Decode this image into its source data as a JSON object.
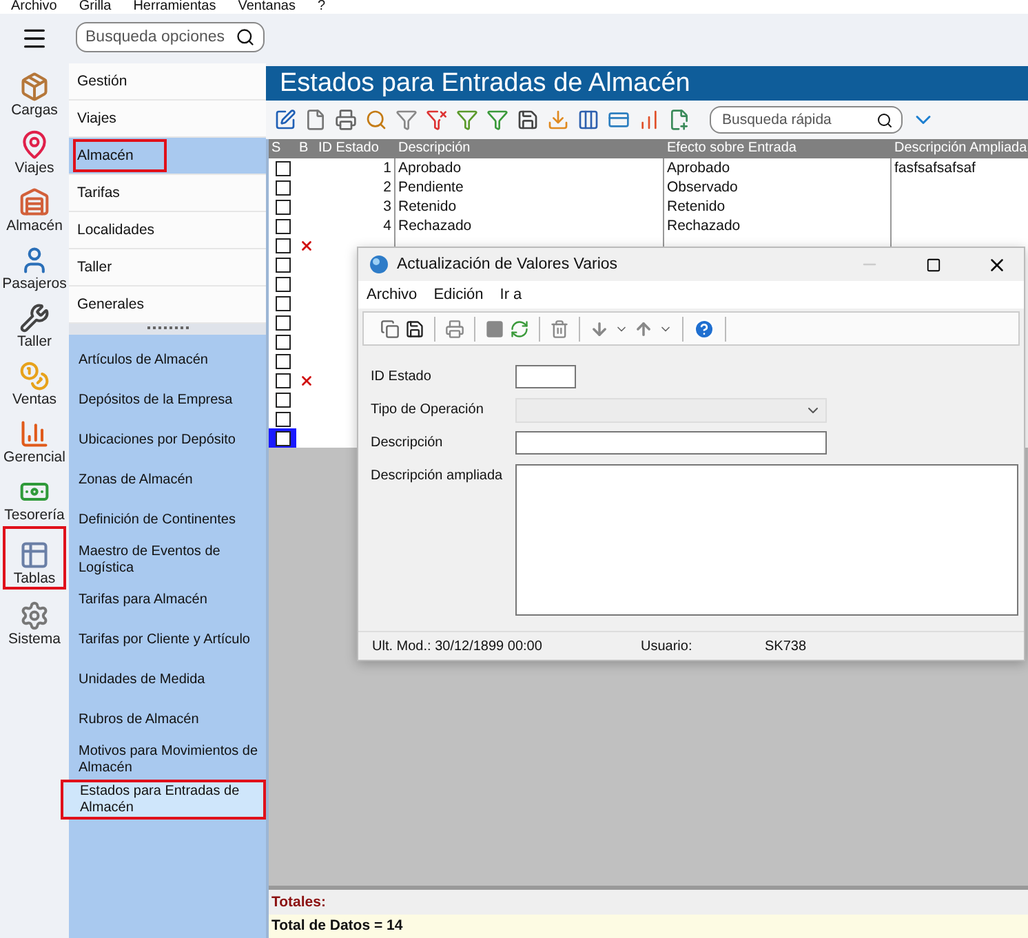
{
  "menubar": [
    "Archivo",
    "Grilla",
    "Herramientas",
    "Ventanas",
    "?"
  ],
  "search": {
    "placeholder": "Busqueda opciones"
  },
  "modules": [
    {
      "label": "Cargas",
      "kind": "package",
      "highlighted": false
    },
    {
      "label": "Viajes",
      "kind": "pin",
      "highlighted": false
    },
    {
      "label": "Almacén",
      "kind": "warehouse",
      "highlighted": false
    },
    {
      "label": "Pasajeros",
      "kind": "person",
      "highlighted": false
    },
    {
      "label": "Taller",
      "kind": "wrench",
      "highlighted": false
    },
    {
      "label": "Ventas",
      "kind": "coins",
      "highlighted": false
    },
    {
      "label": "Gerencial",
      "kind": "chart",
      "highlighted": false
    },
    {
      "label": "Tesorería",
      "kind": "cash",
      "highlighted": false
    },
    {
      "label": "Tablas",
      "kind": "table",
      "highlighted": true
    },
    {
      "label": "Sistema",
      "kind": "gear",
      "highlighted": false
    }
  ],
  "nav_groups": [
    {
      "label": "Gestión",
      "selected": false,
      "highlighted": false
    },
    {
      "label": "Viajes",
      "selected": false,
      "highlighted": false
    },
    {
      "label": "Almacén",
      "selected": true,
      "highlighted": true
    },
    {
      "label": "Tarifas",
      "selected": false,
      "highlighted": false
    },
    {
      "label": "Localidades",
      "selected": false,
      "highlighted": false
    },
    {
      "label": "Taller",
      "selected": false,
      "highlighted": false
    },
    {
      "label": "Generales",
      "selected": false,
      "highlighted": false
    }
  ],
  "nav_items": [
    {
      "label": "Artículos de Almacén",
      "selected": false,
      "highlighted": false
    },
    {
      "label": "Depósitos de la Empresa",
      "selected": false,
      "highlighted": false
    },
    {
      "label": "Ubicaciones por Depósito",
      "selected": false,
      "highlighted": false
    },
    {
      "label": "Zonas de Almacén",
      "selected": false,
      "highlighted": false
    },
    {
      "label": "Definición de Continentes",
      "selected": false,
      "highlighted": false
    },
    {
      "label": "Maestro de Eventos de Logística",
      "selected": false,
      "highlighted": false
    },
    {
      "label": "Tarifas para Almacén",
      "selected": false,
      "highlighted": false
    },
    {
      "label": "Tarifas por Cliente y Artículo",
      "selected": false,
      "highlighted": false
    },
    {
      "label": "Unidades de Medida",
      "selected": false,
      "highlighted": false
    },
    {
      "label": "Rubros de Almacén",
      "selected": false,
      "highlighted": false
    },
    {
      "label": "Motivos para Movimientos de Almacén",
      "selected": false,
      "highlighted": false
    },
    {
      "label": "Estados para Entradas de Almacén",
      "selected": true,
      "highlighted": true
    }
  ],
  "page_title": "Estados para Entradas de Almacén",
  "quick_search": {
    "placeholder": "Busqueda rápida"
  },
  "table": {
    "columns": [
      "S",
      "B",
      "ID Estado",
      "Descripción",
      "Efecto sobre Entrada",
      "Descripción Ampliada"
    ],
    "rows": [
      {
        "checked": false,
        "deleted": false,
        "selected": false,
        "id": "1",
        "description": "Aprobado",
        "effect": "Aprobado",
        "extended": "fasfsafsafsaf"
      },
      {
        "checked": false,
        "deleted": false,
        "selected": false,
        "id": "2",
        "description": "Pendiente",
        "effect": "Observado"
      },
      {
        "checked": false,
        "deleted": false,
        "selected": false,
        "id": "3",
        "description": "Retenido",
        "effect": "Retenido"
      },
      {
        "checked": false,
        "deleted": false,
        "selected": false,
        "id": "4",
        "description": "Rechazado",
        "effect": "Rechazado"
      },
      {
        "checked": false,
        "deleted": true,
        "selected": false
      },
      {
        "checked": false,
        "deleted": false,
        "selected": false
      },
      {
        "checked": false,
        "deleted": false,
        "selected": false
      },
      {
        "checked": false,
        "deleted": false,
        "selected": false
      },
      {
        "checked": false,
        "deleted": false,
        "selected": false
      },
      {
        "checked": false,
        "deleted": false,
        "selected": false
      },
      {
        "checked": false,
        "deleted": false,
        "selected": false
      },
      {
        "checked": false,
        "deleted": true,
        "selected": false
      },
      {
        "checked": false,
        "deleted": false,
        "selected": false
      },
      {
        "checked": false,
        "deleted": false,
        "selected": false
      },
      {
        "checked": false,
        "deleted": false,
        "selected": true
      }
    ]
  },
  "totals": {
    "heading": "Totales:",
    "summary": "Total de Datos = 14"
  },
  "dialog": {
    "title": "Actualización de Valores Varios",
    "menu": [
      "Archivo",
      "Edición",
      "Ir a"
    ],
    "fields": [
      {
        "label": "ID Estado",
        "kind": "short"
      },
      {
        "label": "Tipo de Operación",
        "kind": "select"
      },
      {
        "label": "Descripción",
        "kind": "text"
      },
      {
        "label": "Descripción ampliada",
        "kind": "textarea"
      }
    ],
    "status": {
      "modified": "Ult. Mod.: 30/12/1899 00:00",
      "user_label": "Usuario:",
      "user": "SK738"
    }
  }
}
